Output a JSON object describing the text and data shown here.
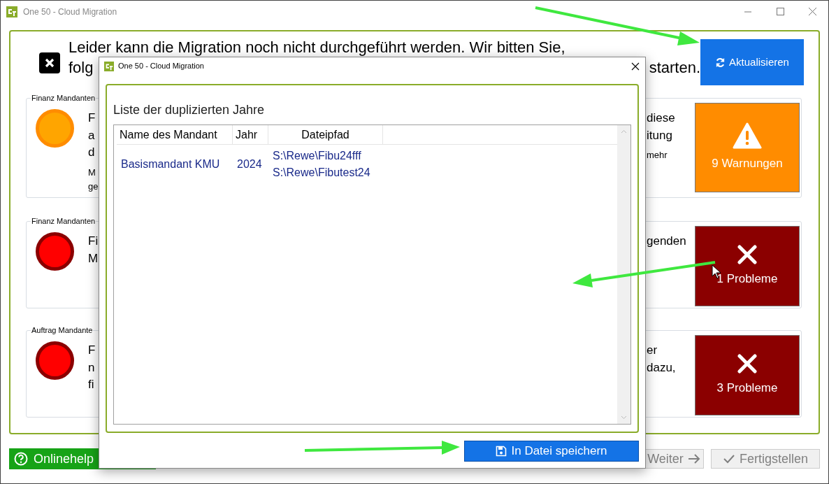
{
  "window": {
    "title": "One 50 - Cloud Migration"
  },
  "heading": {
    "line_1": "Leider kann die Migration noch nicht durchgeführt werden. Wir bitten Sie,",
    "line_2_fragments": [
      "folg",
      "starten."
    ]
  },
  "refresh_button": {
    "label": "Aktualisieren"
  },
  "checks": [
    {
      "group": "Finanz Mandanten",
      "kind": "warning",
      "text_left": [
        "F",
        "a",
        "d"
      ],
      "note_left": [
        "M",
        "ge"
      ],
      "text_right": [
        "diese",
        "itung"
      ],
      "note_right": [
        "mehr"
      ],
      "tile_label": "9 Warnungen"
    },
    {
      "group": "Finanz Mandanten",
      "kind": "error",
      "text_left": [
        "Fi",
        "M"
      ],
      "text_right": [
        "genden"
      ],
      "tile_label": "1 Probleme"
    },
    {
      "group": "Auftrag Mandante",
      "kind": "error",
      "text_left": [
        "F",
        "n",
        "fi"
      ],
      "text_right": [
        "er",
        "dazu,"
      ],
      "tile_label": "3 Probleme"
    }
  ],
  "dialog": {
    "title": "One 50 - Cloud Migration",
    "heading": "Liste der duplizierten Jahre",
    "table": {
      "columns": [
        "Name des Mandant",
        "Jahr",
        "Dateipfad"
      ],
      "rows": [
        {
          "name": "Basismandant KMU",
          "year": "2024",
          "paths": [
            "S:\\Rewe\\Fibu24fff",
            "S:\\Rewe\\Fibutest24"
          ]
        }
      ]
    },
    "save_button": "In Datei speichern"
  },
  "footer": {
    "help_button": "Onlinehelp",
    "next_button": {
      "label": "Weiter",
      "disabled": true
    },
    "finish_button": {
      "label": "Fertigstellen",
      "disabled": true
    }
  }
}
